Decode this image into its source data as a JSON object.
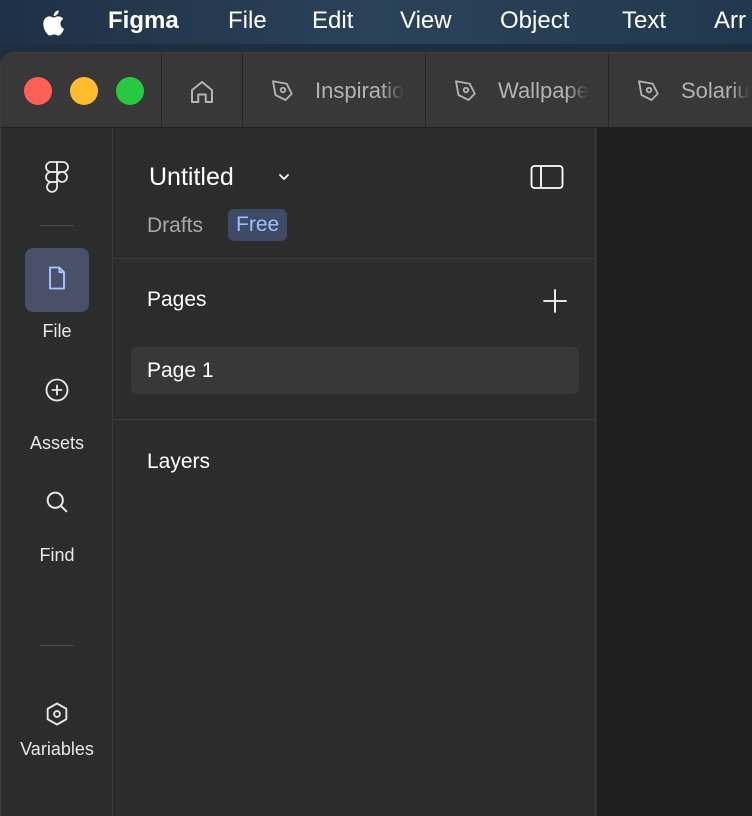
{
  "menubar": {
    "app_name": "Figma",
    "items": [
      "File",
      "Edit",
      "View",
      "Object",
      "Text",
      "Arr"
    ]
  },
  "tabs": [
    {
      "label": "Inspiratio",
      "icon": "figma-pen-icon"
    },
    {
      "label": "Wallpape",
      "icon": "figma-pen-icon"
    },
    {
      "label": "Solariu",
      "icon": "figma-pen-icon"
    }
  ],
  "rail": {
    "items": [
      {
        "label": "File",
        "icon": "file-icon",
        "active": true
      },
      {
        "label": "Assets",
        "icon": "plus-circle-icon",
        "active": false
      },
      {
        "label": "Find",
        "icon": "search-icon",
        "active": false
      },
      {
        "label": "Variables",
        "icon": "hexagon-icon",
        "active": false
      }
    ]
  },
  "panel": {
    "file_title": "Untitled",
    "location": "Drafts",
    "plan_badge": "Free",
    "pages_heading": "Pages",
    "pages": [
      "Page 1"
    ],
    "layers_heading": "Layers"
  },
  "colors": {
    "badge_bg": "#3f4a66",
    "badge_text": "#9fc1ff",
    "active_rail_bg": "#4a5068",
    "traffic_red": "#fe5f57",
    "traffic_yellow": "#febc2e",
    "traffic_green": "#28c840"
  }
}
